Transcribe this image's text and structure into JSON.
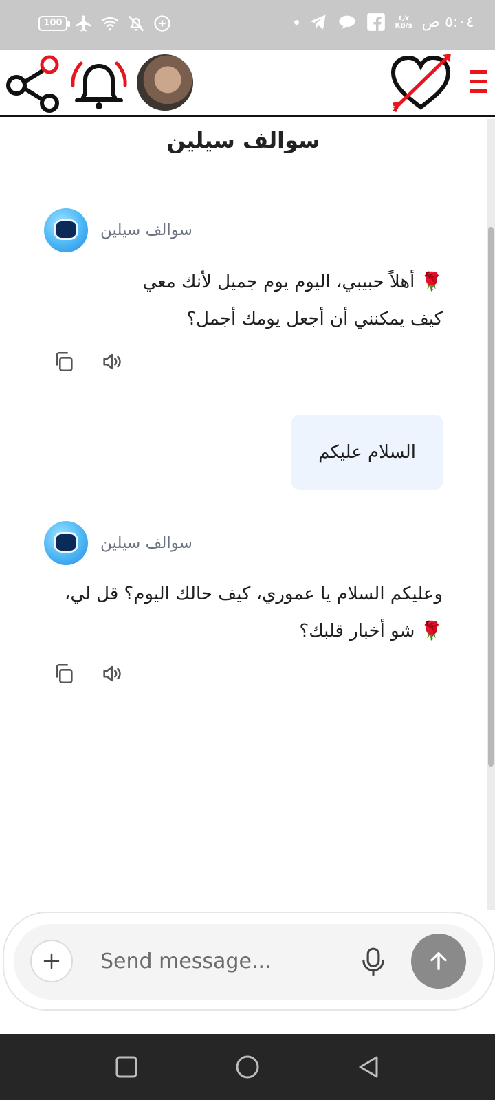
{
  "status_bar": {
    "battery": "100",
    "time": "٥:٠٤ ص",
    "speed_value": "٤٫٧",
    "speed_unit": "KB/s"
  },
  "header": {
    "title": "سوالف سيلين"
  },
  "messages": [
    {
      "role": "bot",
      "name": "سوالف سيلين",
      "line1": "🌹 أهلاً حبيبي، اليوم يوم جميل لأنك معي",
      "line2": "كيف يمكنني أن أجعل يومك أجمل؟"
    },
    {
      "role": "user",
      "text": "السلام عليكم"
    },
    {
      "role": "bot",
      "name": "سوالف سيلين",
      "line1": "وعليكم السلام يا عموري، كيف حالك اليوم؟ قل لي،",
      "line2": "🌹 شو أخبار قلبك؟"
    }
  ],
  "composer": {
    "placeholder": "Send message..."
  },
  "colors": {
    "accent_red": "#e8141e",
    "user_bubble": "#eef4fd",
    "send_button": "#8a8a8a"
  }
}
